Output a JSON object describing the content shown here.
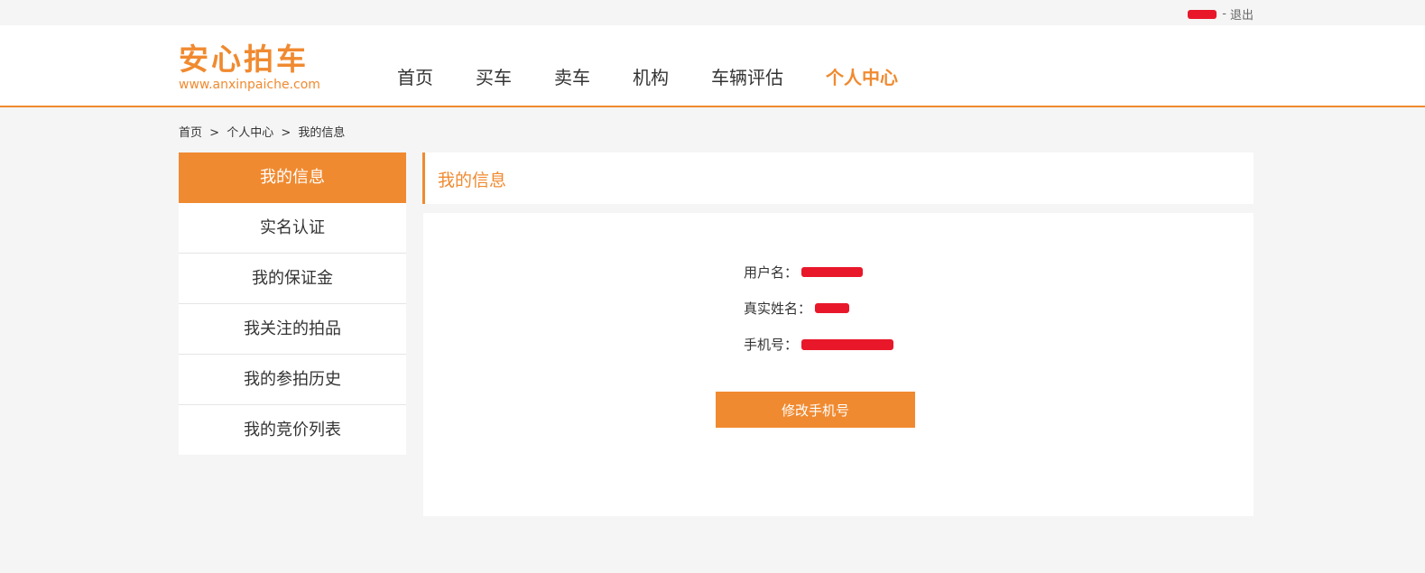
{
  "topbar": {
    "separator": "-",
    "logout_label": "退出"
  },
  "logo": {
    "name": "安心拍车",
    "url": "www.anxinpaiche.com"
  },
  "nav": {
    "items": [
      {
        "label": "首页"
      },
      {
        "label": "买车"
      },
      {
        "label": "卖车"
      },
      {
        "label": "机构"
      },
      {
        "label": "车辆评估"
      },
      {
        "label": "个人中心"
      }
    ],
    "active_index": 5
  },
  "breadcrumb": {
    "home": "首页",
    "sep": ">",
    "center": "个人中心",
    "current": "我的信息"
  },
  "sidebar": {
    "items": [
      {
        "label": "我的信息"
      },
      {
        "label": "实名认证"
      },
      {
        "label": "我的保证金"
      },
      {
        "label": "我关注的拍品"
      },
      {
        "label": "我的参拍历史"
      },
      {
        "label": "我的竞价列表"
      }
    ],
    "active_index": 0
  },
  "panel": {
    "title": "我的信息",
    "username_label": "用户名：",
    "realname_label": "真实姓名：",
    "phone_label": "手机号：",
    "change_phone_button": "修改手机号"
  },
  "colors": {
    "accent": "#f08a30",
    "redaction": "#e8182a",
    "background": "#f5f5f5"
  }
}
